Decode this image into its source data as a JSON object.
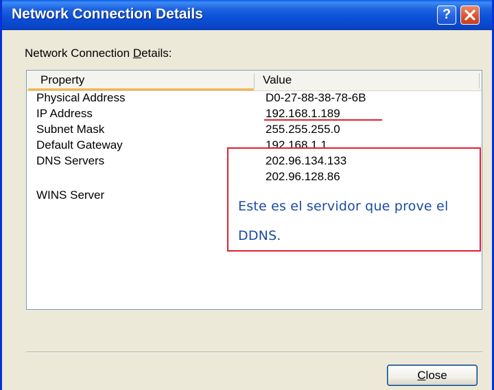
{
  "window": {
    "title": "Network Connection Details",
    "help_icon": "help-icon",
    "help_glyph": "?",
    "close_icon": "close-x-icon"
  },
  "section": {
    "label_prefix": "Network Connection ",
    "label_accel": "D",
    "label_suffix": "etails:"
  },
  "table": {
    "columns": [
      "Property",
      "Value"
    ],
    "rows": [
      {
        "property": "Physical Address",
        "value": "D0-27-88-38-78-6B"
      },
      {
        "property": "IP Address",
        "value": "192.168.1.189"
      },
      {
        "property": "Subnet Mask",
        "value": "255.255.255.0"
      },
      {
        "property": "Default Gateway",
        "value": "192.168.1.1"
      },
      {
        "property": "DNS Servers",
        "value": "202.96.134.133"
      },
      {
        "property": "",
        "value": "202.96.128.86"
      },
      {
        "property": "WINS Server",
        "value": ""
      }
    ]
  },
  "annotation": {
    "text": "Este es el servidor que prove el DDNS.",
    "color": "#e0202a",
    "text_color": "#1a4aa3"
  },
  "footer": {
    "close_accel": "C",
    "close_suffix": "lose"
  },
  "colors": {
    "titlebar": "#0a4fd6",
    "dialog_bg": "#ece9d8",
    "sort_highlight": "#f3b54c"
  }
}
